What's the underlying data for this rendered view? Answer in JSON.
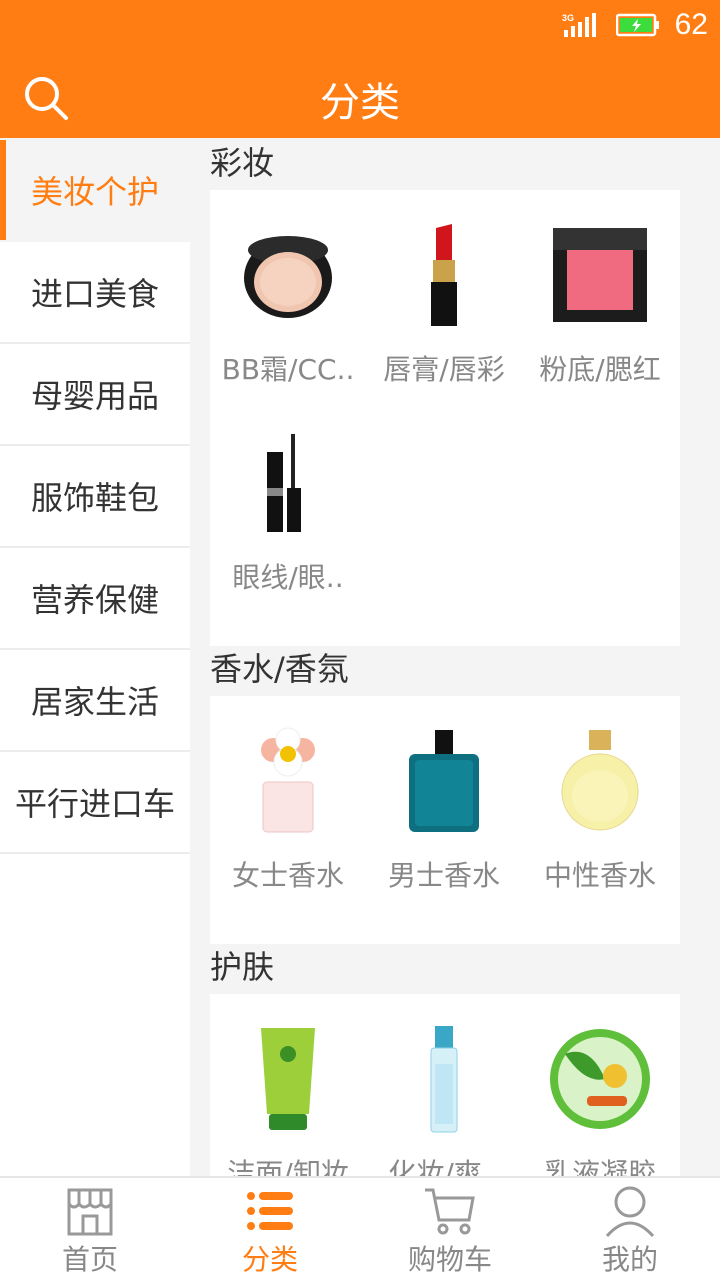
{
  "status": {
    "battery_pct": "62",
    "network": "3G"
  },
  "header": {
    "title": "分类"
  },
  "sidebar": {
    "items": [
      {
        "label": "美妆个护"
      },
      {
        "label": "进口美食"
      },
      {
        "label": "母婴用品"
      },
      {
        "label": "服饰鞋包"
      },
      {
        "label": "营养保健"
      },
      {
        "label": "居家生活"
      },
      {
        "label": "平行进口车"
      }
    ]
  },
  "sections": [
    {
      "title": "彩妆",
      "products": [
        {
          "name": "BB霜/CC..",
          "icon": "cushion-compact-icon"
        },
        {
          "name": "唇膏/唇彩",
          "icon": "lipstick-icon"
        },
        {
          "name": "粉底/腮红",
          "icon": "blush-palette-icon"
        },
        {
          "name": "眼线/眼..",
          "icon": "mascara-icon"
        }
      ]
    },
    {
      "title": "香水/香氛",
      "products": [
        {
          "name": "女士香水",
          "icon": "womens-perfume-icon"
        },
        {
          "name": "男士香水",
          "icon": "mens-perfume-icon"
        },
        {
          "name": "中性香水",
          "icon": "unisex-perfume-icon"
        }
      ]
    },
    {
      "title": "护肤",
      "products": [
        {
          "name": "洁面/卸妆",
          "icon": "cleanser-tube-icon"
        },
        {
          "name": "化妆/爽..",
          "icon": "toner-bottle-icon"
        },
        {
          "name": "乳液凝胶",
          "icon": "aloe-gel-jar-icon"
        }
      ]
    }
  ],
  "tabbar": {
    "items": [
      {
        "label": "首页",
        "icon": "storefront-icon"
      },
      {
        "label": "分类",
        "icon": "list-icon"
      },
      {
        "label": "购物车",
        "icon": "cart-icon"
      },
      {
        "label": "我的",
        "icon": "user-icon"
      }
    ]
  },
  "colors": {
    "accent": "#ff7d12",
    "text": "#333333",
    "muted": "#888888"
  }
}
